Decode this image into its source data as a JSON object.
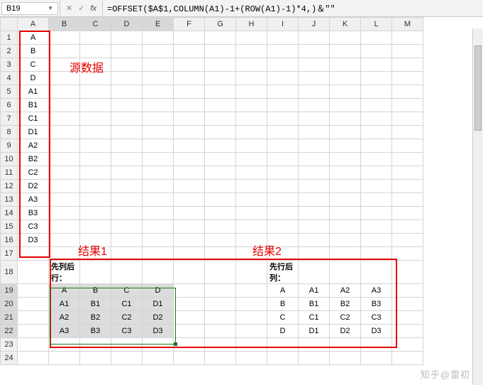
{
  "nameBox": "B19",
  "formula": "=OFFSET($A$1,COLUMN(A1)-1+(ROW(A1)-1)*4,)＆\"\"",
  "columns": [
    "A",
    "B",
    "C",
    "D",
    "E",
    "F",
    "G",
    "H",
    "I",
    "J",
    "K",
    "L",
    "M"
  ],
  "rows": [
    "1",
    "2",
    "3",
    "4",
    "5",
    "6",
    "7",
    "8",
    "9",
    "10",
    "11",
    "12",
    "13",
    "14",
    "15",
    "16",
    "17",
    "18",
    "19",
    "20",
    "21",
    "22",
    "23",
    "24"
  ],
  "sourceData": [
    "A",
    "B",
    "C",
    "D",
    "A1",
    "B1",
    "C1",
    "D1",
    "A2",
    "B2",
    "C2",
    "D2",
    "A3",
    "B3",
    "C3",
    "D3"
  ],
  "labels": {
    "source": "源数据",
    "result1": "结果1",
    "result2": "结果2",
    "header1": "先列后行：",
    "header2": "先行后列："
  },
  "result1": [
    [
      "A",
      "B",
      "C",
      "D"
    ],
    [
      "A1",
      "B1",
      "C1",
      "D1"
    ],
    [
      "A2",
      "B2",
      "C2",
      "D2"
    ],
    [
      "A3",
      "B3",
      "C3",
      "D3"
    ]
  ],
  "result2": [
    [
      "A",
      "A1",
      "A2",
      "A3"
    ],
    [
      "B",
      "B1",
      "B2",
      "B3"
    ],
    [
      "C",
      "C1",
      "C2",
      "C3"
    ],
    [
      "D",
      "D1",
      "D2",
      "D3"
    ]
  ],
  "watermark": "知乎@雷初",
  "chart_data": {
    "type": "table",
    "title": "Excel single-column to 4-column reshape via OFFSET",
    "source_column": [
      "A",
      "B",
      "C",
      "D",
      "A1",
      "B1",
      "C1",
      "D1",
      "A2",
      "B2",
      "C2",
      "D2",
      "A3",
      "B3",
      "C3",
      "D3"
    ],
    "col_first_then_row": [
      [
        "A",
        "B",
        "C",
        "D"
      ],
      [
        "A1",
        "B1",
        "C1",
        "D1"
      ],
      [
        "A2",
        "B2",
        "C2",
        "D2"
      ],
      [
        "A3",
        "B3",
        "C3",
        "D3"
      ]
    ],
    "row_first_then_col": [
      [
        "A",
        "A1",
        "A2",
        "A3"
      ],
      [
        "B",
        "B1",
        "B2",
        "B3"
      ],
      [
        "C",
        "C1",
        "C2",
        "C3"
      ],
      [
        "D",
        "D1",
        "D2",
        "D3"
      ]
    ],
    "formula_shown": "=OFFSET($A$1,COLUMN(A1)-1+(ROW(A1)-1)*4,)＆\"\""
  }
}
